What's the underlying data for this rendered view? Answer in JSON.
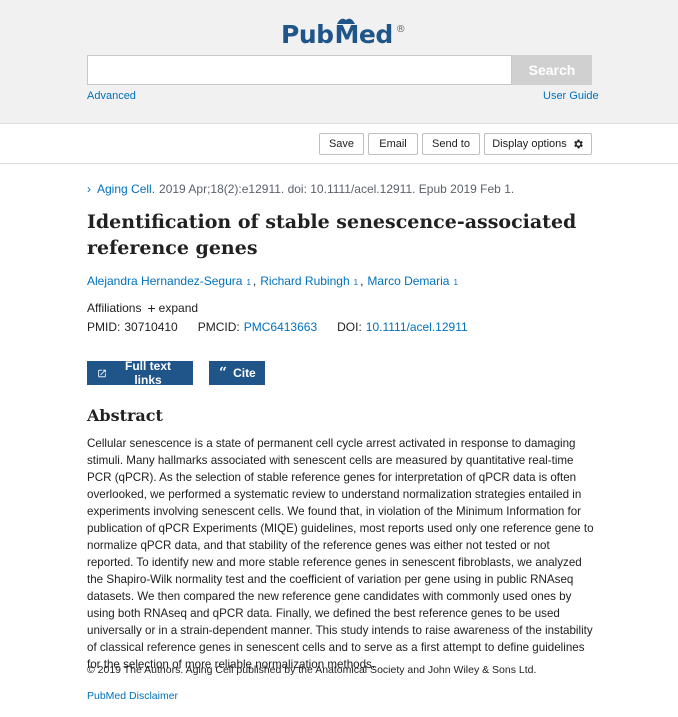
{
  "header": {
    "logo_pub": "Pub",
    "logo_med": "Med",
    "logo_reg": "®",
    "search_placeholder": "",
    "search_button": "Search",
    "advanced_link": "Advanced",
    "user_guide_link": "User Guide"
  },
  "toolbar": {
    "save": "Save",
    "email": "Email",
    "send_to": "Send to",
    "display_options": "Display options"
  },
  "citation": {
    "journal": "Aging Cell.",
    "details": "2019 Apr;18(2):e12911. doi: 10.1111/acel.12911. Epub 2019 Feb 1."
  },
  "article": {
    "title": "Identification of stable senescence-associated reference genes",
    "authors": [
      {
        "name": "Alejandra Hernandez-Segura",
        "affil": "1"
      },
      {
        "name": "Richard Rubingh",
        "affil": "1"
      },
      {
        "name": "Marco Demaria",
        "affil": "1"
      }
    ],
    "affiliations_label": "Affiliations",
    "expand_label": "expand",
    "pmid_label": "PMID:",
    "pmid": "30710410",
    "pmcid_label": "PMCID:",
    "pmcid": "PMC6413663",
    "doi_label": "DOI:",
    "doi": "10.1111/acel.12911"
  },
  "actions": {
    "full_text": "Full text links",
    "cite": "Cite"
  },
  "abstract": {
    "heading": "Abstract",
    "text": "Cellular senescence is a state of permanent cell cycle arrest activated in response to damaging stimuli. Many hallmarks associated with senescent cells are measured by quantitative real-time PCR (qPCR). As the selection of stable reference genes for interpretation of qPCR data is often overlooked, we performed a systematic review to understand normalization strategies entailed in experiments involving senescent cells. We found that, in violation of the Minimum Information for publication of qPCR Experiments (MIQE) guidelines, most reports used only one reference gene to normalize qPCR data, and that stability of the reference genes was either not tested or not reported. To identify new and more stable reference genes in senescent fibroblasts, we analyzed the Shapiro-Wilk normality test and the coefficient of variation per gene using in public RNAseq datasets. We then compared the new reference gene candidates with commonly used ones by using both RNAseq and qPCR data. Finally, we defined the best reference genes to be used universally or in a strain-dependent manner. This study intends to raise awareness of the instability of classical reference genes in senescent cells and to serve as a first attempt to define guidelines for the selection of more reliable normalization methods."
  },
  "footer": {
    "copyright": "© 2019 The Authors. Aging Cell published by the Anatomical Society and John Wiley & Sons Ltd.",
    "disclaimer": "PubMed Disclaimer"
  },
  "colors": {
    "brand_blue": "#20558a",
    "link_blue": "#0071bc",
    "search_button_gray": "#d0d0d0"
  },
  "icons": [
    "pubmed-book-icon",
    "gear-icon",
    "chevron-right-icon",
    "plus-icon",
    "external-link-icon",
    "quote-icon"
  ]
}
